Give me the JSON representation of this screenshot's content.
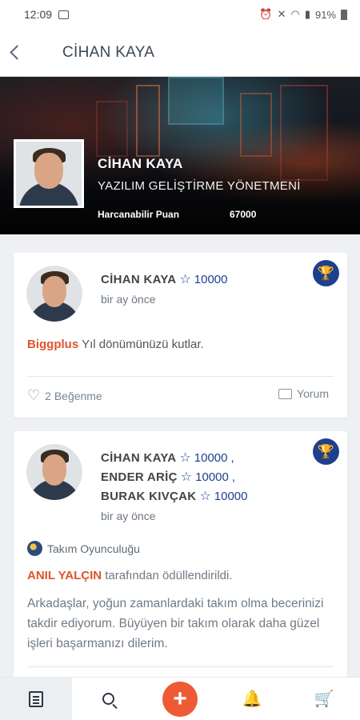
{
  "status": {
    "time": "12:09",
    "battery": "91%"
  },
  "appbar": {
    "title": "CİHAN KAYA"
  },
  "profile": {
    "name": "CİHAN KAYA",
    "role": "YAZILIM GELİŞTİRME YÖNETMENİ",
    "points_label": "Harcanabilir Puan",
    "points_value": "67000"
  },
  "feed": [
    {
      "recipients": [
        {
          "name": "CİHAN KAYA",
          "points": "10000"
        }
      ],
      "time_ago": "bir ay önce",
      "sender": "Biggplus",
      "message": "Yıl dönümünüzü kutlar.",
      "likes": "2 Beğenme",
      "comment_label": "Yorum"
    },
    {
      "recipients": [
        {
          "name": "CİHAN KAYA",
          "points": "10000",
          "sep": ","
        },
        {
          "name": "ENDER ARİÇ",
          "points": "10000",
          "sep": ","
        },
        {
          "name": "BURAK KIVÇAK",
          "points": "10000",
          "sep": ""
        }
      ],
      "time_ago": "bir ay önce",
      "badge": "Takım Oyunculuğu",
      "sender": "ANIL YALÇIN",
      "awarded_text": "tarafından ödüllendirildi.",
      "body": "Arkadaşlar, yoğun zamanlardaki takım olma becerinizi takdir ediyorum. Büyüyen bir takım olarak daha güzel işleri başarmanızı dilerim."
    }
  ],
  "nav": {
    "add_label": "+"
  }
}
